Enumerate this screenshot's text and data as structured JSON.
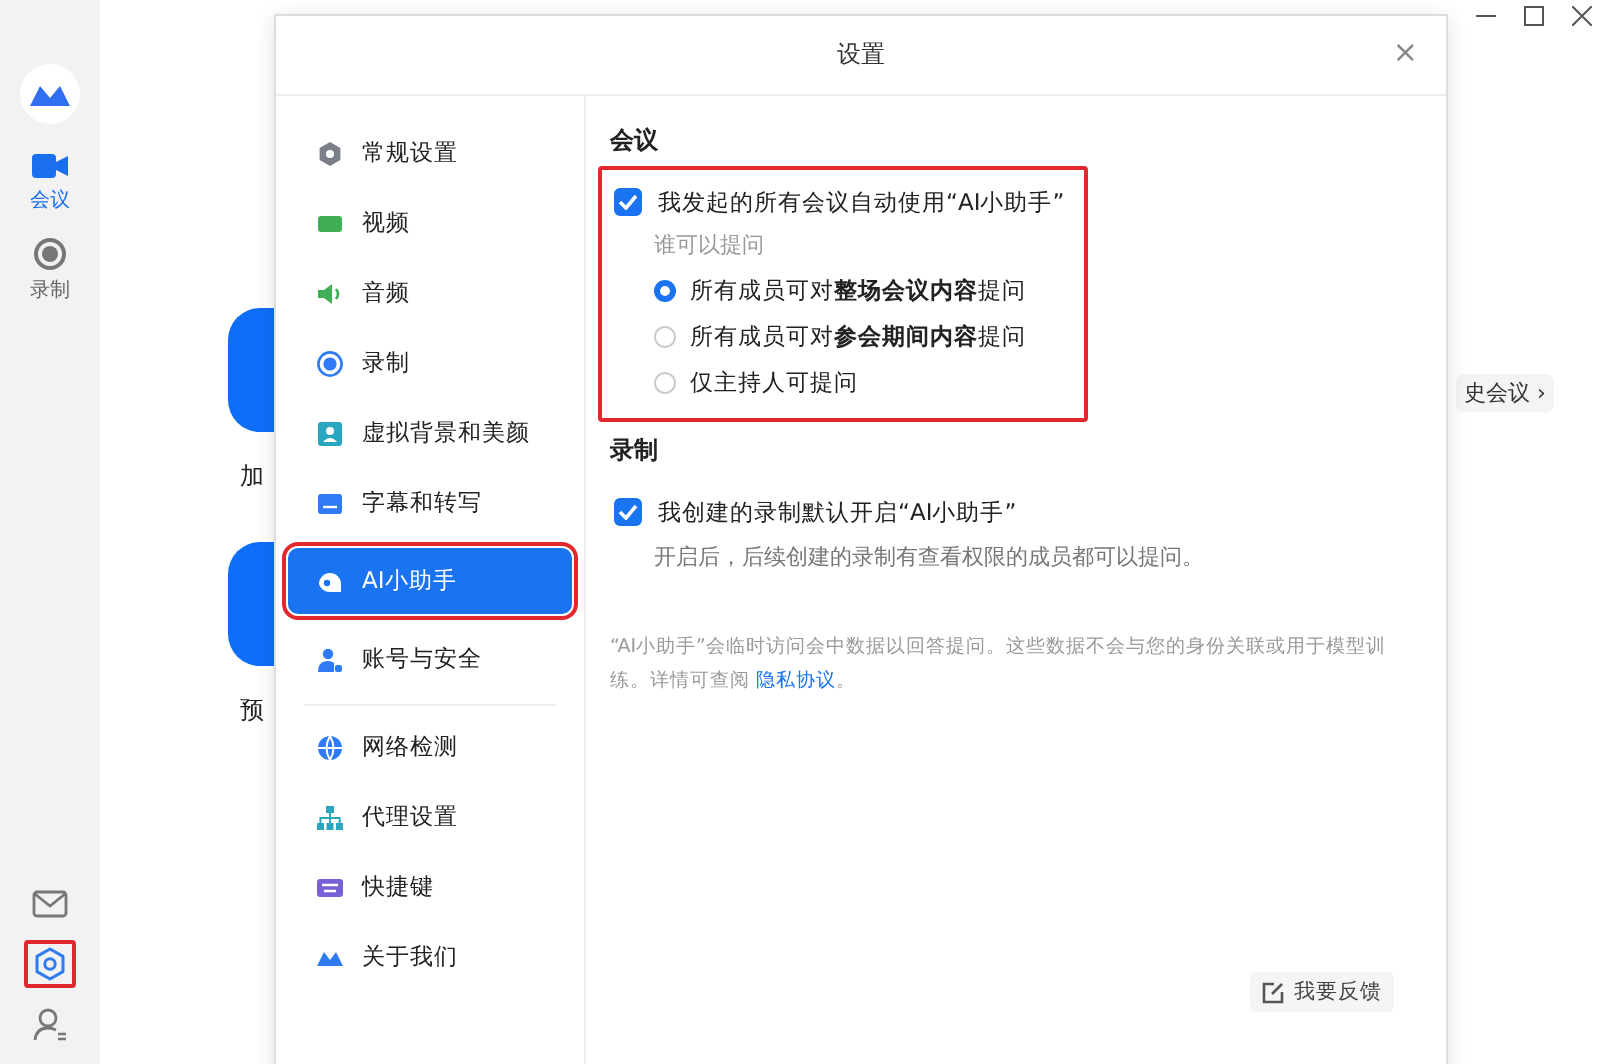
{
  "rail": {
    "items": [
      {
        "label": "会议",
        "kind": "video",
        "selected": true
      },
      {
        "label": "录制",
        "kind": "record",
        "selected": false
      }
    ],
    "bottom": [
      {
        "kind": "mail",
        "highlighted": false
      },
      {
        "kind": "settings",
        "highlighted": true
      },
      {
        "kind": "user",
        "highlighted": false
      }
    ]
  },
  "background": {
    "tiles": [
      {
        "label": "加"
      },
      {
        "label": "预"
      }
    ],
    "history_link": "史会议 ›"
  },
  "dialog": {
    "title": "设置",
    "close": "×",
    "nav": [
      {
        "label": "常规设置",
        "kind": "gear",
        "color": "#7a7f8a",
        "selected": false,
        "highlighted": false
      },
      {
        "label": "视频",
        "kind": "video",
        "color": "#3fae55",
        "selected": false,
        "highlighted": false
      },
      {
        "label": "音频",
        "kind": "speaker",
        "color": "#3fae55",
        "selected": false,
        "highlighted": false
      },
      {
        "label": "录制",
        "kind": "record",
        "color": "#2f7bf5",
        "selected": false,
        "highlighted": false
      },
      {
        "label": "虚拟背景和美颜",
        "kind": "portrait",
        "color": "#2aa7c0",
        "selected": false,
        "highlighted": false
      },
      {
        "label": "字幕和转写",
        "kind": "caption",
        "color": "#2f7bf5",
        "selected": false,
        "highlighted": false
      },
      {
        "label": "AI小助手",
        "kind": "ai",
        "color": "#ffffff",
        "selected": true,
        "highlighted": true
      },
      {
        "label": "账号与安全",
        "kind": "account",
        "color": "#2f7bf5",
        "selected": false,
        "highlighted": false
      },
      {
        "label": "网络检测",
        "kind": "globe",
        "color": "#2f7bf5",
        "selected": false,
        "highlighted": false
      },
      {
        "label": "代理设置",
        "kind": "network",
        "color": "#2aa7c0",
        "selected": false,
        "highlighted": false
      },
      {
        "label": "快捷键",
        "kind": "keyboard",
        "color": "#7b5fd6",
        "selected": false,
        "highlighted": false
      },
      {
        "label": "关于我们",
        "kind": "logo",
        "color": "#2f7bf5",
        "selected": false,
        "highlighted": false
      }
    ],
    "sections": [
      {
        "heading": "会议",
        "highlighted": true,
        "checkbox": {
          "label": "我发起的所有会议自动使用“AI小助手”",
          "checked": true
        },
        "sublabel": "谁可以提问",
        "options": [
          {
            "label": "所有成员可对**整场会议内容**提问",
            "selected": true
          },
          {
            "label": "所有成员可对**参会期间内容**提问",
            "selected": false
          },
          {
            "label": "仅主持人可提问",
            "selected": false
          }
        ]
      },
      {
        "heading": "录制",
        "checkbox": {
          "label": "我创建的录制默认开启“AI小助手”",
          "checked": true
        },
        "description": "开启后，后续创建的录制有查看权限的成员都可以提问。"
      }
    ],
    "note": "“AI小助手”会临时访问会中数据以回答提问。这些数据不会与您的身份关联或用于模型训练。详情可查阅",
    "note_link": "隐私协议",
    "note_end": "。",
    "feedback": "我要反馈"
  }
}
